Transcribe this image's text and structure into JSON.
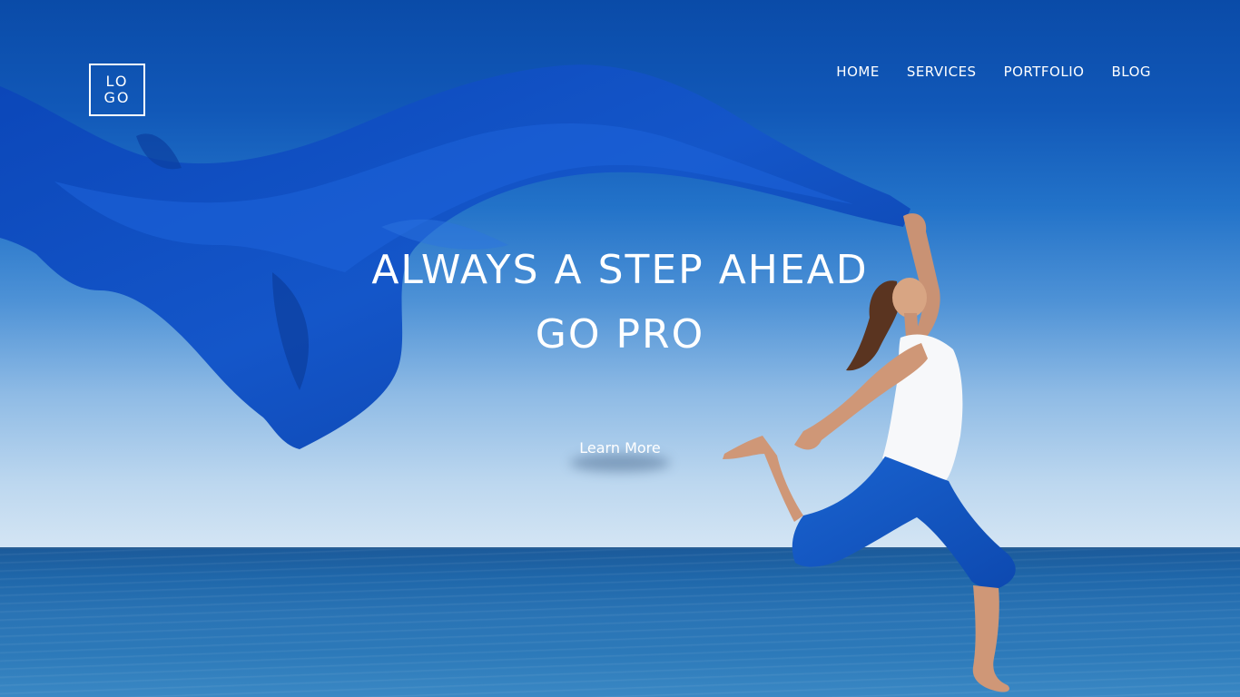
{
  "logo": {
    "line1": "LO",
    "line2": "GO"
  },
  "nav": {
    "items": [
      {
        "label": "HOME"
      },
      {
        "label": "SERVICES"
      },
      {
        "label": "PORTFOLIO"
      },
      {
        "label": "BLOG"
      }
    ]
  },
  "hero": {
    "headline_line1": "ALWAYS A STEP AHEAD",
    "headline_line2": "GO PRO",
    "cta_label": "Learn More",
    "background_image": "woman-running-with-blue-scarf-on-beach"
  },
  "colors": {
    "sky_top": "#0a4ba8",
    "sky_bottom": "#d4e5f4",
    "sea": "#1f67aa",
    "scarf": "#0f4fc0",
    "text": "#ffffff"
  }
}
